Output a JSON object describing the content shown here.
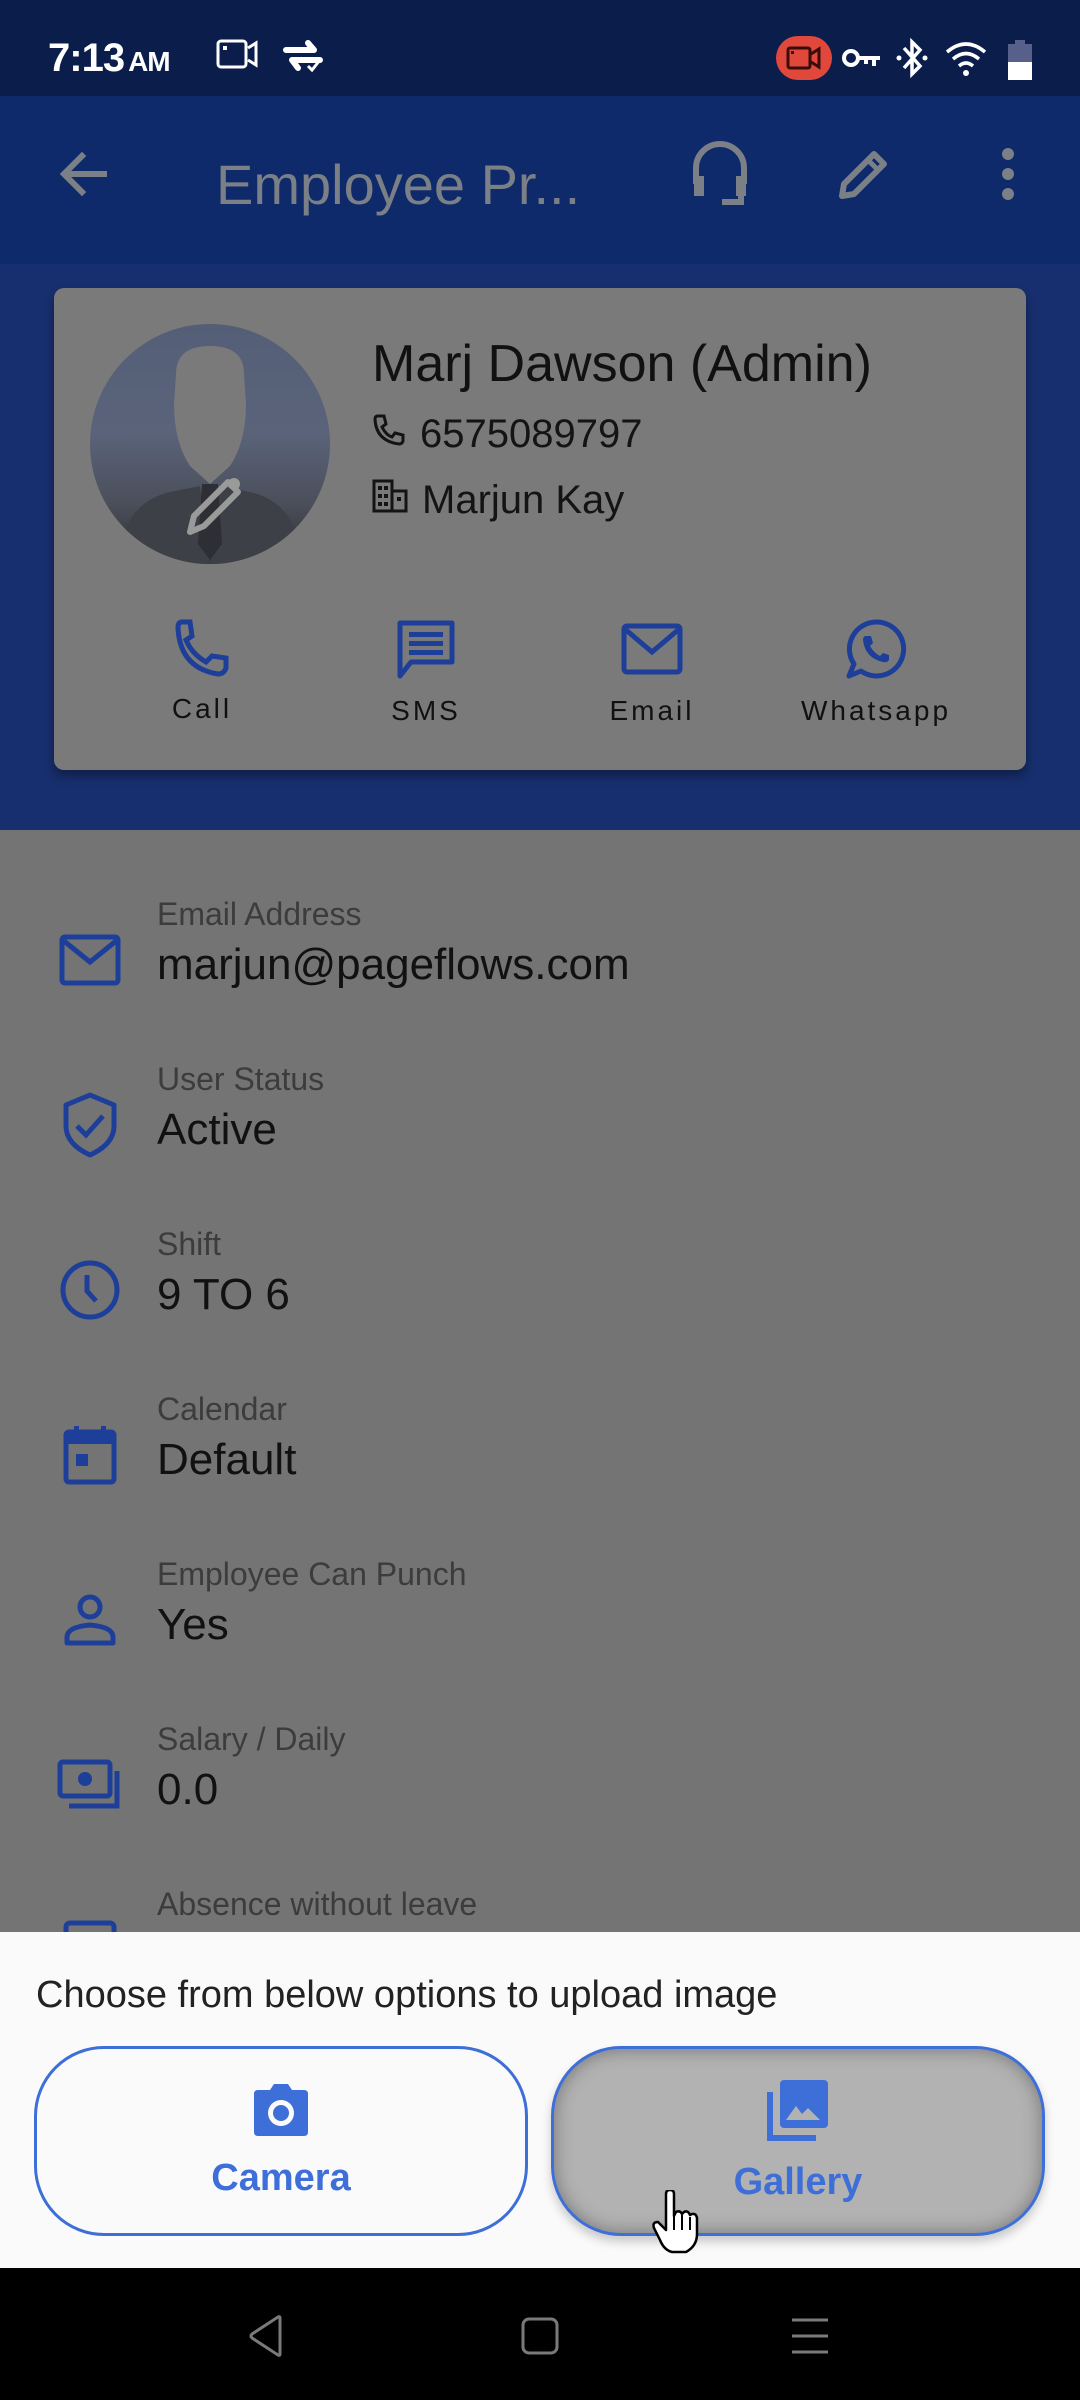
{
  "status_bar": {
    "time": "7:13",
    "ampm": "AM",
    "left_icons": [
      "screen-record-icon",
      "sync-check-icon"
    ],
    "right_icons": [
      "recording-badge-icon",
      "vpn-key-icon",
      "bluetooth-icon",
      "wifi-icon",
      "battery-icon"
    ],
    "recording_badge_color": "#e0483c"
  },
  "app_bar": {
    "title": "Employee Pr...",
    "back_icon": "arrow-back-icon",
    "actions": [
      "headset-icon",
      "edit-icon",
      "more-vert-icon"
    ]
  },
  "profile": {
    "name": "Marj Dawson (Admin)",
    "phone": "6575089797",
    "company": "Marjun Kay",
    "avatar_icon": "default-avatar-icon",
    "avatar_edit_icon": "pencil-icon",
    "actions": [
      {
        "label": "Call",
        "icon": "phone-icon"
      },
      {
        "label": "SMS",
        "icon": "message-icon"
      },
      {
        "label": "Email",
        "icon": "mail-icon"
      },
      {
        "label": "Whatsapp",
        "icon": "whatsapp-icon"
      }
    ]
  },
  "details": [
    {
      "label": "Email Address",
      "value": "marjun@pageflows.com",
      "icon": "mail-icon"
    },
    {
      "label": "User Status",
      "value": "Active",
      "icon": "shield-check-icon"
    },
    {
      "label": "Shift",
      "value": "9 TO 6",
      "icon": "clock-icon"
    },
    {
      "label": "Calendar",
      "value": "Default",
      "icon": "calendar-icon"
    },
    {
      "label": "Employee Can Punch",
      "value": "Yes",
      "icon": "person-icon"
    },
    {
      "label": "Salary / Daily",
      "value": "0.0",
      "icon": "money-icon"
    },
    {
      "label": "Absence without leave",
      "value": "",
      "icon": "list-icon"
    }
  ],
  "upload_sheet": {
    "title": "Choose from below options to upload image",
    "camera_label": "Camera",
    "gallery_label": "Gallery",
    "accent_color": "#3e6fd8"
  },
  "colors": {
    "icon_blue": "#1d3f9a",
    "app_bar": "#0e2a6b",
    "status_bar": "#0b1d4b"
  }
}
